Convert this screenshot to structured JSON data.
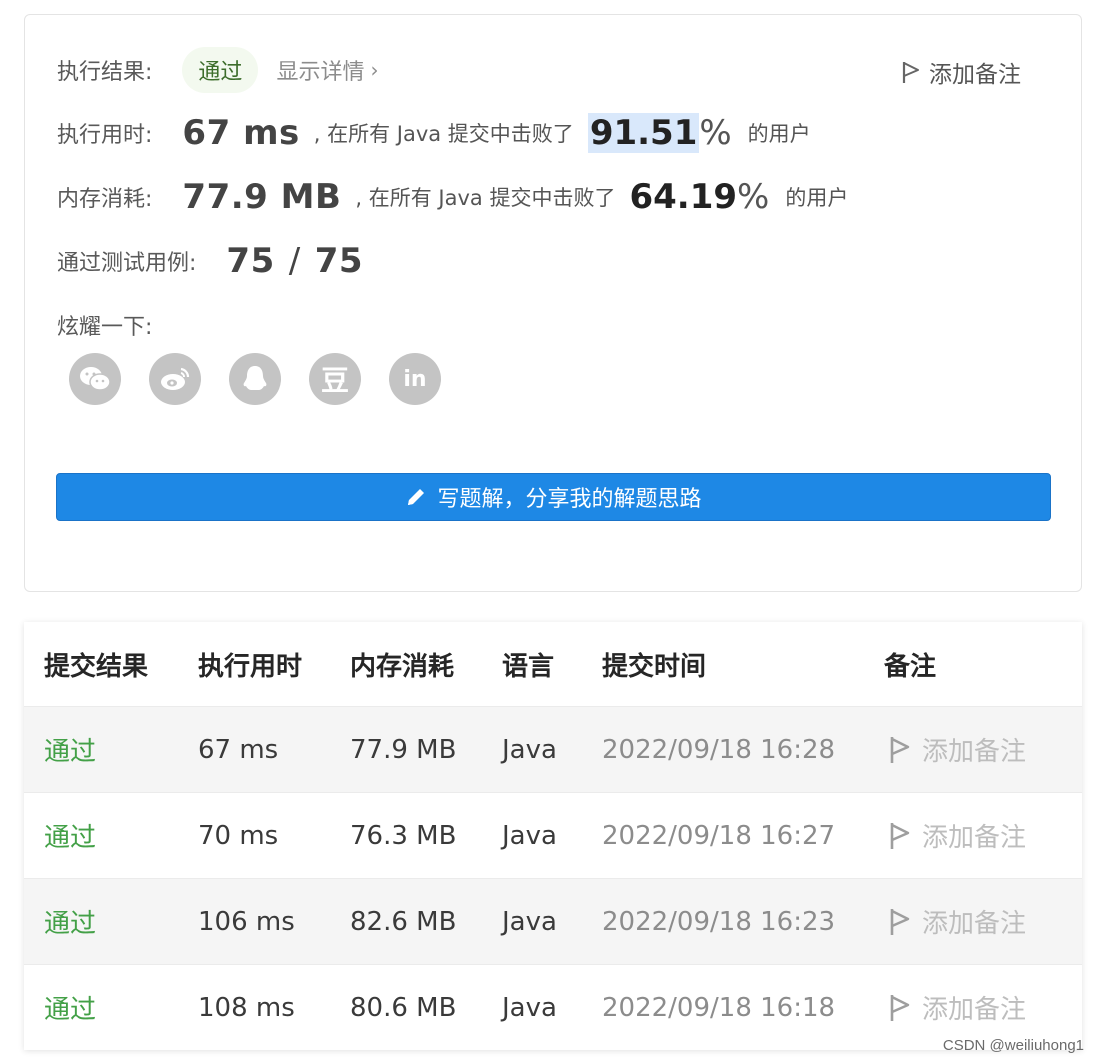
{
  "result": {
    "exec_result_label": "执行结果:",
    "status": "通过",
    "details_link": "显示详情",
    "add_note": "添加备注",
    "time": {
      "label": "执行用时:",
      "value": "67 ms",
      "middle": ", 在所有 Java 提交中击败了",
      "percent": "91.51",
      "percent_sign": "%",
      "suffix": "的用户"
    },
    "memory": {
      "label": "内存消耗:",
      "value": "77.9 MB",
      "middle": ", 在所有 Java 提交中击败了",
      "percent": "64.19",
      "percent_sign": "%",
      "suffix": "的用户"
    },
    "tests": {
      "label": "通过测试用例:",
      "passed": "75",
      "separator": "/",
      "total": "75"
    },
    "share_label": "炫耀一下:",
    "share_icons": [
      "wechat-icon",
      "weibo-icon",
      "qq-icon",
      "douban-icon",
      "linkedin-icon"
    ],
    "douban_glyph": "豆",
    "linkedin_glyph": "in",
    "write_solution": "写题解，分享我的解题思路"
  },
  "table": {
    "headers": [
      "提交结果",
      "执行用时",
      "内存消耗",
      "语言",
      "提交时间",
      "备注"
    ],
    "rows": [
      {
        "status": "通过",
        "time": "67 ms",
        "memory": "77.9 MB",
        "lang": "Java",
        "submitted": "2022/09/18 16:28",
        "note": "添加备注"
      },
      {
        "status": "通过",
        "time": "70 ms",
        "memory": "76.3 MB",
        "lang": "Java",
        "submitted": "2022/09/18 16:27",
        "note": "添加备注"
      },
      {
        "status": "通过",
        "time": "106 ms",
        "memory": "82.6 MB",
        "lang": "Java",
        "submitted": "2022/09/18 16:23",
        "note": "添加备注"
      },
      {
        "status": "通过",
        "time": "108 ms",
        "memory": "80.6 MB",
        "lang": "Java",
        "submitted": "2022/09/18 16:18",
        "note": "添加备注"
      }
    ]
  },
  "watermark": "CSDN @weiliuhong1",
  "colors": {
    "accent": "#1e88e5",
    "pass_green": "#43a047",
    "highlight": "#d9e8fb"
  }
}
